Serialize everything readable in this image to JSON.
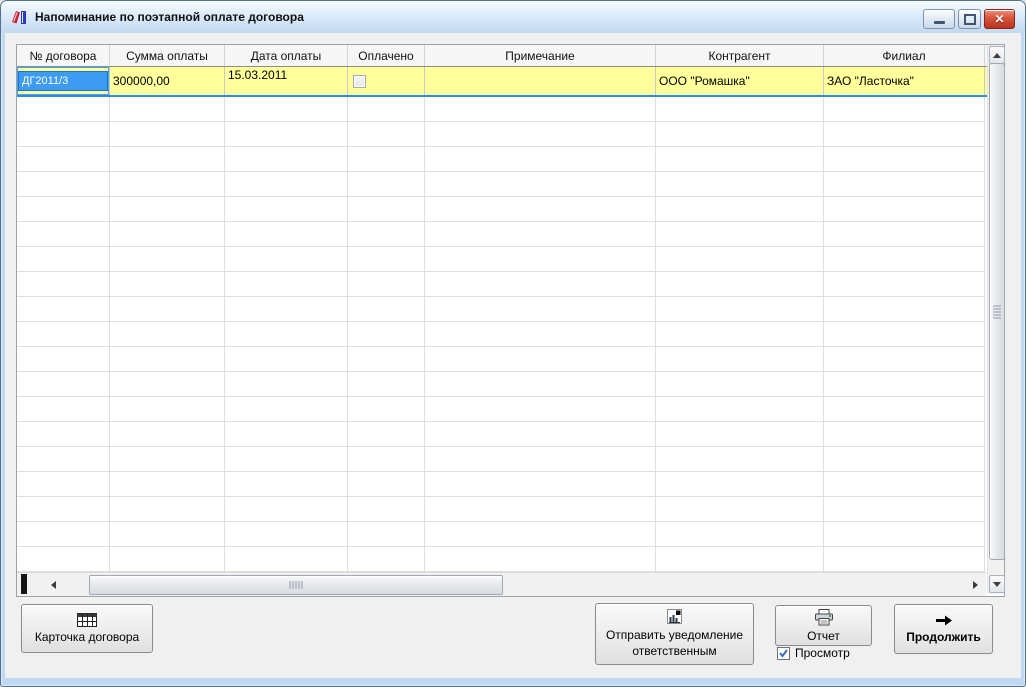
{
  "window": {
    "title": "Напоминание по поэтапной оплате договора"
  },
  "table": {
    "columns": [
      "№ договора",
      "Сумма оплаты",
      "Дата оплаты",
      "Оплачено",
      "Примечание",
      "Контрагент",
      "Филиал"
    ],
    "rows": [
      {
        "contract_no": "ДГ2011/3",
        "amount": "300000,00",
        "pay_date": "15.03.2011",
        "paid": false,
        "note": "",
        "counterparty": "ООО \"Ромашка\"",
        "branch": "ЗАО \"Ласточка\""
      }
    ],
    "empty_row_count": 19
  },
  "buttons": {
    "contract_card": "Карточка договора",
    "send_notification": "Отправить уведомление ответственным",
    "report": "Отчет",
    "preview": "Просмотр",
    "preview_checked": true,
    "continue": "Продолжить"
  },
  "colors": {
    "row_highlight": "#ffff9c",
    "cell_selection": "#3d9bf2",
    "row_current_border": "#2f8be8",
    "close_button": "#c33c28"
  }
}
